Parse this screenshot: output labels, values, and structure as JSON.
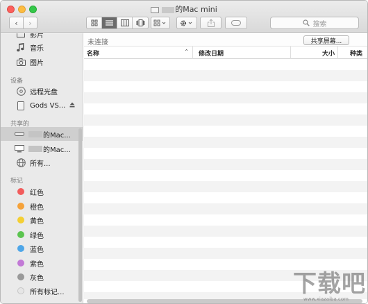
{
  "window": {
    "title": "的Mac mini"
  },
  "toolbar": {
    "back_glyph": "‹",
    "forward_glyph": "›",
    "view_modes": [
      "icon-view",
      "list-view",
      "column-view",
      "cover-flow-view"
    ],
    "active_view": "list-view",
    "search_placeholder": "搜索"
  },
  "sidebar": {
    "favorites_partial": "影片",
    "items_top": [
      {
        "label": "音乐",
        "icon": "music-icon"
      },
      {
        "label": "图片",
        "icon": "camera-icon"
      }
    ],
    "devices_header": "设备",
    "devices": [
      {
        "label": "远程光盘",
        "icon": "disc-icon"
      },
      {
        "label": "Gods VS...",
        "icon": "drive-icon",
        "eject": true
      }
    ],
    "shared_header": "共享的",
    "shared": [
      {
        "label": "的Mac...",
        "icon": "mac-mini-icon",
        "selected": true,
        "redacted": true
      },
      {
        "label": "的Mac...",
        "icon": "display-icon",
        "redacted": true
      },
      {
        "label": "所有...",
        "icon": "network-icon"
      }
    ],
    "tags_header": "标记",
    "tags": [
      {
        "label": "红色",
        "color": "#f25c5c"
      },
      {
        "label": "橙色",
        "color": "#f5a23a"
      },
      {
        "label": "黄色",
        "color": "#f4cf33"
      },
      {
        "label": "绿色",
        "color": "#5bc44f"
      },
      {
        "label": "蓝色",
        "color": "#4ea6e8"
      },
      {
        "label": "紫色",
        "color": "#c27ad6"
      },
      {
        "label": "灰色",
        "color": "#9a9a9a"
      },
      {
        "label": "所有标记...",
        "color": "#e0e0e0"
      }
    ]
  },
  "content": {
    "status": "未连接",
    "share_screen_button": "共享屏幕...",
    "columns": {
      "name": "名称",
      "date": "修改日期",
      "size": "大小",
      "kind": "种类"
    },
    "sort_indicator": "⌃"
  },
  "watermark": {
    "text": "下载吧",
    "url": "www.xiazaiba.com"
  }
}
